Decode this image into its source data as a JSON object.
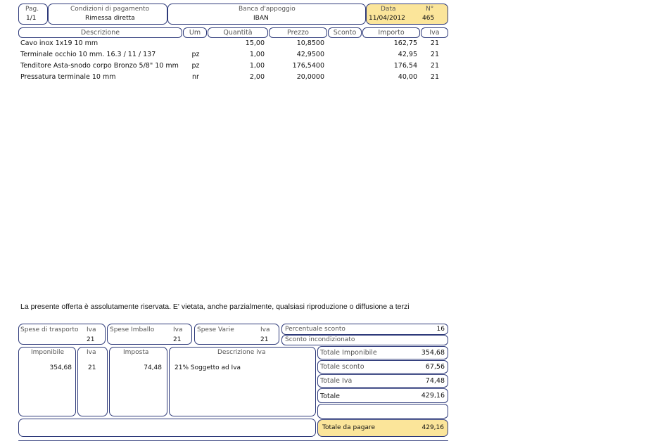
{
  "header": {
    "page_label": "Pag.",
    "page_value": "1/1",
    "payment_label": "Condizioni di pagamento",
    "payment_value": "Rimessa diretta",
    "bank_label": "Banca d'appoggio",
    "bank_value": "IBAN",
    "date_label": "Data",
    "date_value": "11/04/2012",
    "number_label": "N°",
    "number_value": "465"
  },
  "columns": {
    "descrizione": "Descrizione",
    "um": "Um",
    "quantita": "Quantità",
    "prezzo": "Prezzo",
    "sconto": "Sconto",
    "importo": "Importo",
    "iva": "Iva"
  },
  "items": [
    {
      "descrizione": "Cavo inox 1x19 10 mm",
      "um": "",
      "quantita": "15,00",
      "prezzo": "10,8500",
      "sconto": "",
      "importo": "162,75",
      "iva": "21"
    },
    {
      "descrizione": "Terminale occhio 10 mm. 16.3 / 11 / 137",
      "um": "pz",
      "quantita": "1,00",
      "prezzo": "42,9500",
      "sconto": "",
      "importo": "42,95",
      "iva": "21"
    },
    {
      "descrizione": "Tenditore Asta-snodo corpo Bronzo 5/8\" 10 mm",
      "um": "pz",
      "quantita": "1,00",
      "prezzo": "176,5400",
      "sconto": "",
      "importo": "176,54",
      "iva": "21"
    },
    {
      "descrizione": "Pressatura terminale 10 mm",
      "um": "nr",
      "quantita": "2,00",
      "prezzo": "20,0000",
      "sconto": "",
      "importo": "40,00",
      "iva": "21"
    }
  ],
  "notice": "La presente offerta è assolutamente riservata. E' vietata, anche parzialmente, qualsiasi riproduzione o diffusione a terzi",
  "costs": {
    "trasporto_label": "Spese di trasporto",
    "trasporto_iva_label": "Iva",
    "trasporto_iva": "21",
    "imballo_label": "Spese Imballo",
    "imballo_iva_label": "Iva",
    "imballo_iva": "21",
    "varie_label": "Spese Varie",
    "varie_iva_label": "Iva",
    "varie_iva": "21",
    "percentuale_sconto_label": "Percentuale sconto",
    "percentuale_sconto": "16",
    "sconto_incondizionato_label": "Sconto incondizionato"
  },
  "vat": {
    "imponibile_label": "Imponibile",
    "iva_label": "Iva",
    "imposta_label": "Imposta",
    "descrizione_label": "Descrizione iva",
    "imponibile": "354,68",
    "iva": "21",
    "imposta": "74,48",
    "descrizione": "21% Soggetto ad Iva"
  },
  "totals": {
    "imponibile_label": "Totale Imponibile",
    "imponibile": "354,68",
    "sconto_label": "Totale sconto",
    "sconto": "67,56",
    "iva_label": "Totale Iva",
    "iva": "74,48",
    "totale_label": "Totale",
    "totale": "429,16",
    "da_pagare_label": "Totale da pagare",
    "da_pagare": "429,16"
  },
  "colors": {
    "border": "#2e3a7a",
    "highlight": "#fbe59a"
  }
}
